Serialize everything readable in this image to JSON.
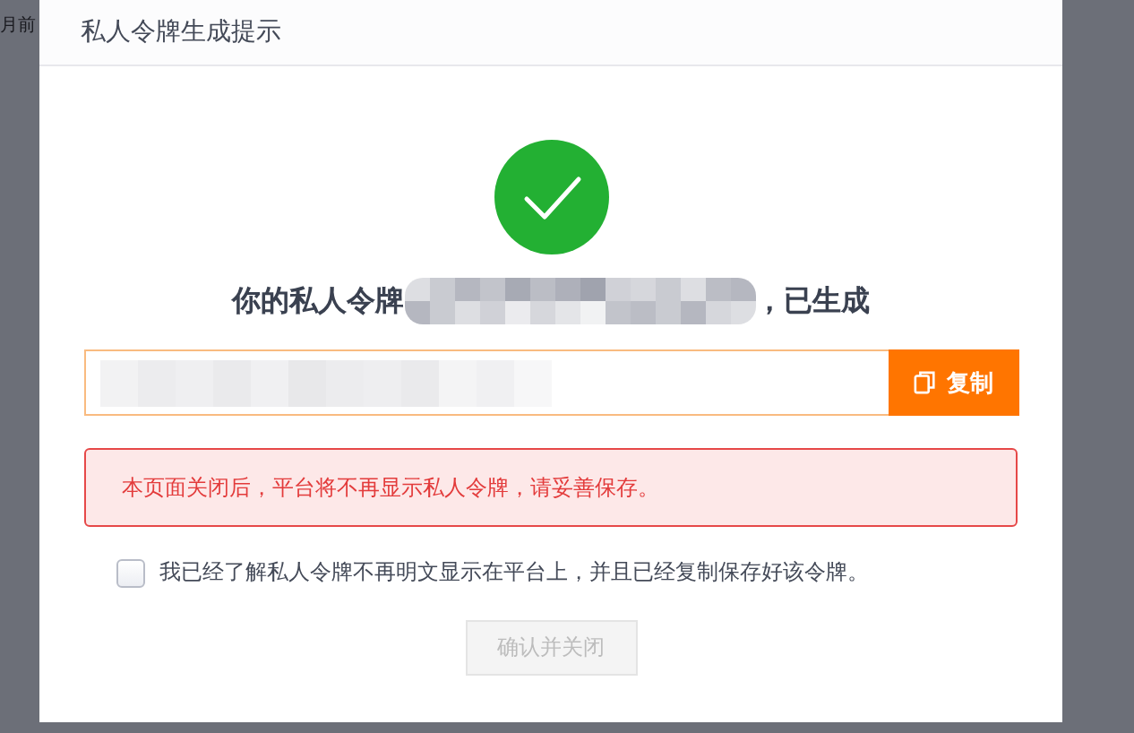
{
  "background": {
    "text": "月前"
  },
  "dialog": {
    "title": "私人令牌生成提示",
    "heading_start": "你的私人令牌",
    "heading_end": "，已生成",
    "copy_button": "复制",
    "alert": "本页面关闭后，平台将不再显示私人令牌，请妥善保存。",
    "agreement": {
      "label": "我已经了解私人令牌不再明文显示在平台上，并且已经复制保存好该令牌。",
      "checked": false
    },
    "confirm_button": {
      "label": "确认并关闭",
      "disabled": true
    }
  }
}
